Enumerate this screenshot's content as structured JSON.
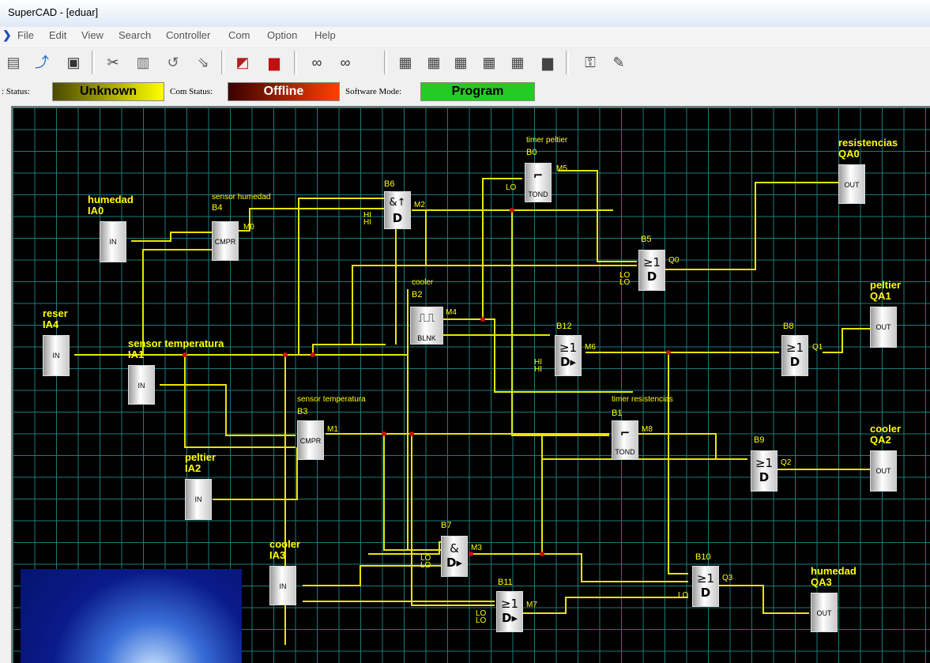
{
  "window": {
    "title": "SuperCAD - [eduar]"
  },
  "menu": [
    "File",
    "Edit",
    "View",
    "Search",
    "Controller",
    "Com",
    "Option",
    "Help"
  ],
  "toolbar": [
    "new-icon",
    "open-icon",
    "save-icon",
    "cut-icon",
    "copy-icon",
    "paste-icon",
    "undo-icon",
    "redo-icon",
    "edit-icon",
    "monitor-icon",
    "link-icon",
    "unlink-icon",
    "read-icon",
    "write-icon",
    "run-icon",
    "stop-icon",
    "download-icon",
    "upload-icon",
    "screen-icon",
    "key-icon",
    "pen-icon"
  ],
  "status": {
    "plc_label": ": Status:",
    "plc_value": "Unknown",
    "com_label": "Com Status:",
    "com_value": "Offline",
    "mode_label": "Software Mode:",
    "mode_value": "Program",
    "colors": {
      "unknown": "#d4d400",
      "offline": "#b02000",
      "program": "#22cc22"
    }
  },
  "blocks": {
    "ia0": {
      "name": "humedad",
      "addr": "IA0",
      "text": "IN"
    },
    "ia4": {
      "name": "reser",
      "addr": "IA4",
      "text": "IN"
    },
    "ia1": {
      "name": "sensor temperatura",
      "addr": "IA1",
      "text": "IN"
    },
    "ia2": {
      "name": "peltier",
      "addr": "IA2",
      "text": "IN"
    },
    "ia3": {
      "name": "cooler",
      "addr": "IA3",
      "text": "IN"
    },
    "b4": {
      "desc": "sensor humedad",
      "id": "B4",
      "text": "CMPR",
      "out": "M0"
    },
    "b6": {
      "id": "B6",
      "sym": "&↑",
      "sym2": "D",
      "out": "M2",
      "pins": "HI\nHI"
    },
    "b0": {
      "desc": "timer peltier",
      "id": "B0",
      "text": "TOND",
      "out": "M5",
      "pin": "LO"
    },
    "b2": {
      "desc": "cooler",
      "id": "B2",
      "text": "BLNK",
      "out": "M4"
    },
    "b5": {
      "id": "B5",
      "sym": "≥1",
      "sym2": "D",
      "out": "Q0",
      "pins": "LO\nLO"
    },
    "b12": {
      "id": "B12",
      "sym": "≥1",
      "sym2": "D▸",
      "out": "M6",
      "pins": "HI\nHI"
    },
    "b8": {
      "id": "B8",
      "sym": "≥1",
      "sym2": "D",
      "out": "Q1"
    },
    "b3": {
      "desc": "sensor  temperatura",
      "id": "B3",
      "text": "CMPR",
      "out": "M1"
    },
    "b1": {
      "desc": "timer resistencias",
      "id": "B1",
      "text": "TOND",
      "out": "M8"
    },
    "b9": {
      "id": "B9",
      "sym": "≥1",
      "sym2": "D",
      "out": "Q2"
    },
    "b7": {
      "id": "B7",
      "sym": "&",
      "sym2": "D▸",
      "out": "M3",
      "pins": "LO\nLO"
    },
    "b11": {
      "id": "B11",
      "sym": "≥1",
      "sym2": "D▸",
      "out": "M7",
      "pins": "LO\nLO"
    },
    "b10": {
      "id": "B10",
      "sym": "≥1",
      "sym2": "D",
      "out": "Q3",
      "pin": "LO"
    },
    "qa0": {
      "name": "resistencias",
      "addr": "QA0",
      "text": "OUT"
    },
    "qa1": {
      "name": "peltier",
      "addr": "QA1",
      "text": "OUT"
    },
    "qa2": {
      "name": "cooler",
      "addr": "QA2",
      "text": "OUT"
    },
    "qa3": {
      "name": "humedad",
      "addr": "QA3",
      "text": "OUT"
    }
  }
}
